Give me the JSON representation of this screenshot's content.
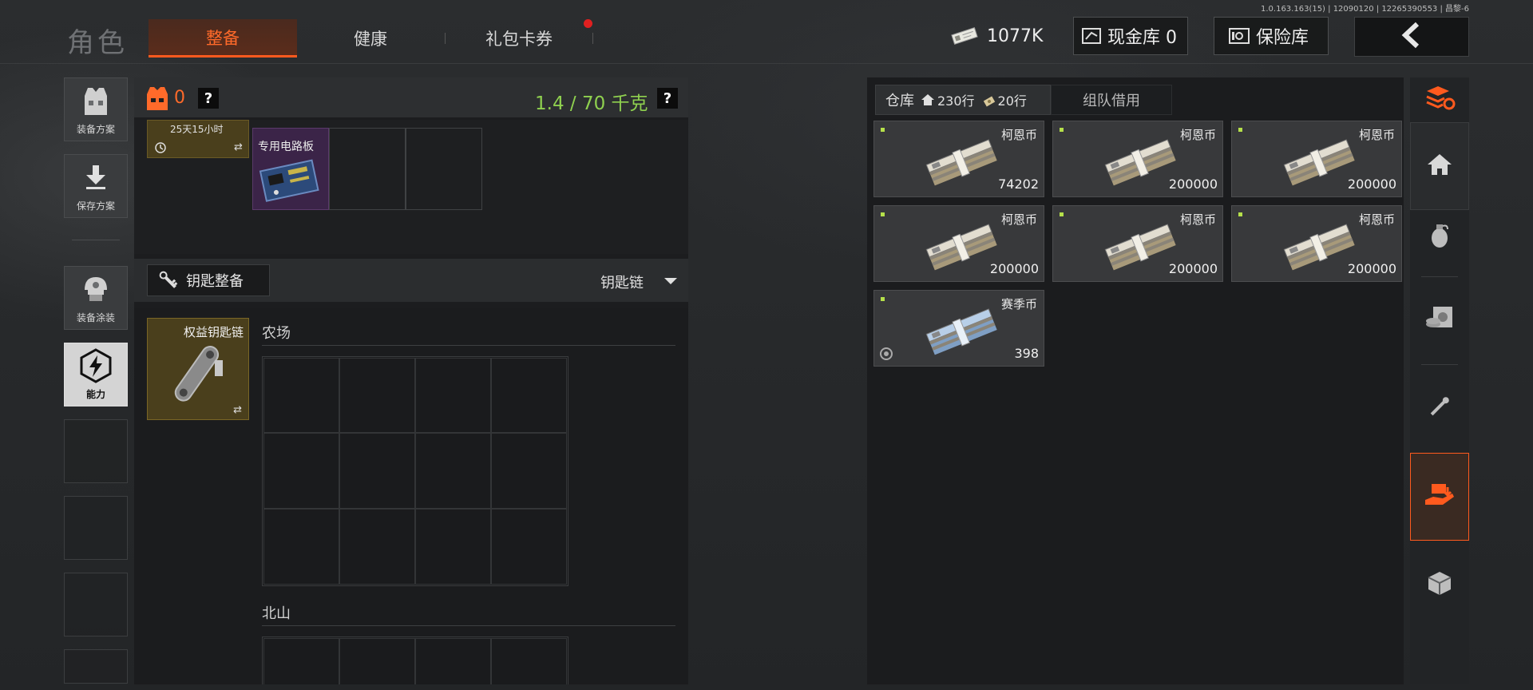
{
  "version_text": "1.0.163.163(15) | 12090120 | 12265390553 | 昌黎-6",
  "header": {
    "role_title": "角色",
    "tabs": [
      {
        "label": "整备",
        "active": true
      },
      {
        "label": "健康",
        "active": false
      },
      {
        "label": "礼包卡券",
        "active": false,
        "badge": "red-dot"
      }
    ],
    "currency_amount": "1077K",
    "cash_vault_label": "现金库 0",
    "safe_label": "保险库",
    "colors": {
      "accent": "#ff5a1e",
      "weight_green": "#8fd14f",
      "slot_purple": "#3b2448",
      "slot_gold": "#5a4a1e"
    }
  },
  "left_nav": [
    {
      "label": "装备方案",
      "icon": "vest-icon"
    },
    {
      "label": "保存方案",
      "icon": "download-icon"
    },
    {
      "label": "装备涂装",
      "icon": "helmet-icon"
    },
    {
      "label": "能力",
      "icon": "lightning-hex-icon",
      "active": true
    }
  ],
  "loadout": {
    "armor_count": "0",
    "weight": "1.4 / 70 千克",
    "timer_item_text": "25天15小时",
    "circuit_board_label": "专用电路板",
    "key_section_title": "钥匙整备",
    "key_chain_selector": "钥匙链",
    "key_item_label": "权益钥匙链",
    "areas": [
      {
        "label": "农场"
      },
      {
        "label": "北山"
      }
    ]
  },
  "warehouse": {
    "tab_label": "仓库",
    "storage_count": "230行",
    "ticket_count": "20行",
    "team_tab_label": "组队借用",
    "items": [
      {
        "name": "柯恩币",
        "amount": "74202",
        "kind": "koen"
      },
      {
        "name": "柯恩币",
        "amount": "200000",
        "kind": "koen"
      },
      {
        "name": "柯恩币",
        "amount": "200000",
        "kind": "koen"
      },
      {
        "name": "柯恩币",
        "amount": "200000",
        "kind": "koen"
      },
      {
        "name": "柯恩币",
        "amount": "200000",
        "kind": "koen"
      },
      {
        "name": "柯恩币",
        "amount": "200000",
        "kind": "koen"
      },
      {
        "name": "赛季币",
        "amount": "398",
        "kind": "season"
      }
    ]
  },
  "right_nav": [
    {
      "icon": "stack-refresh-icon",
      "active": false
    },
    {
      "icon": "home-icon",
      "active": false
    },
    {
      "icon": "grenade-icon",
      "active": false
    },
    {
      "icon": "safe-box-icon",
      "active": false
    },
    {
      "icon": "key-icon",
      "active": false
    },
    {
      "icon": "hand-deposit-icon",
      "active": true
    },
    {
      "icon": "cube-box-icon",
      "active": false
    }
  ]
}
